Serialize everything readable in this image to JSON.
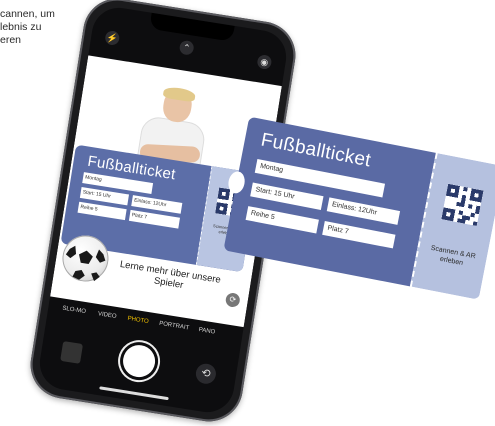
{
  "intro": {
    "text": "cannen, um\nlebnis zu\neren"
  },
  "camera": {
    "modes": [
      "SLO-MO",
      "VIDEO",
      "PHOTO",
      "PORTRAIT",
      "PANO"
    ],
    "active_mode": "PHOTO",
    "flip_icon": "camera-flip-icon",
    "flash_icon": "flash-icon",
    "chevron_icon": "chevron-up-icon",
    "live_icon": "live-photo-icon"
  },
  "ticket": {
    "title": "Fußballticket",
    "fields": {
      "day": "Montag",
      "start": "Start: 15 Uhr",
      "entry": "Einlass: 12Uhr",
      "row": "Reihe 5",
      "seat": "Platz 7"
    },
    "stub_text": "Scannen & AR erleben"
  },
  "small_ticket": {
    "title": "Fußballticket",
    "fields": {
      "day": "Montag",
      "start": "Start: 15 Uhr",
      "entry": "Einlass: 12Uhr",
      "row": "Reihe 5",
      "seat": "Platz 7"
    },
    "stub_text": "Scannen & AR erleben"
  },
  "overlay": {
    "learn_more": "Lerne mehr über unsere Spieler",
    "ar_icon": "ar-icon"
  },
  "colors": {
    "ticket_blue": "#5a6aa4",
    "stub_blue": "#b5c1df",
    "active_mode": "#f5c400"
  }
}
